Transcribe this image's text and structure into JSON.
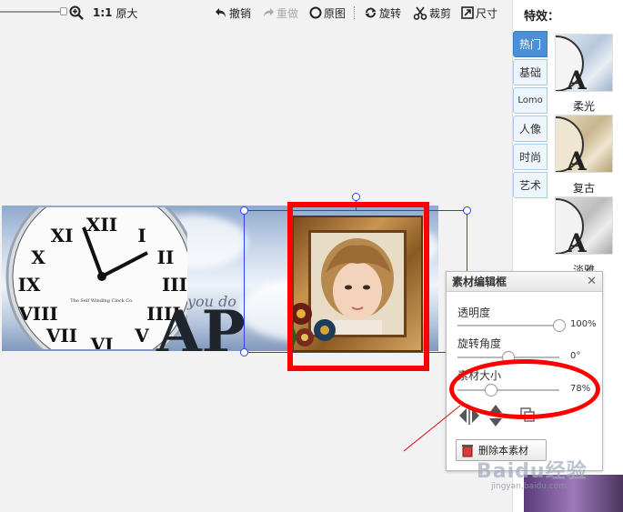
{
  "toolbar": {
    "zoom_1to1": "1:1",
    "zoom_original": "原大",
    "undo": "撤销",
    "redo": "重做",
    "original": "原图",
    "rotate": "旋转",
    "crop": "裁剪",
    "size": "尺寸"
  },
  "effects_panel": {
    "title": "特效：",
    "tabs": [
      "热门",
      "基础",
      "Lomo",
      "人像",
      "时尚",
      "艺术"
    ],
    "active_tab": "热门",
    "thumbnails": [
      {
        "label": "柔光"
      },
      {
        "label": "复古"
      },
      {
        "label": "淡雅"
      }
    ]
  },
  "canvas": {
    "banner_text_big": "AP",
    "banner_text_you": "you do",
    "clock_caption": "The Self Winding Clock Co."
  },
  "edit_dialog": {
    "title": "素材编辑框",
    "close_label": "✕",
    "opacity_label": "透明度",
    "opacity_value": "100%",
    "opacity_fraction": 1.0,
    "rotation_label": "旋转角度",
    "rotation_value": "0°",
    "rotation_fraction": 0.5,
    "size_label": "素材大小",
    "size_value": "78%",
    "size_fraction": 0.33,
    "delete_button": "删除本素材"
  },
  "watermark": {
    "text": "Baidu经验",
    "sub": "jingyan.baidu.com"
  },
  "colors": {
    "accent": "#4a8fd8",
    "selection": "#2f3fff",
    "annotation": "#ff0000"
  }
}
